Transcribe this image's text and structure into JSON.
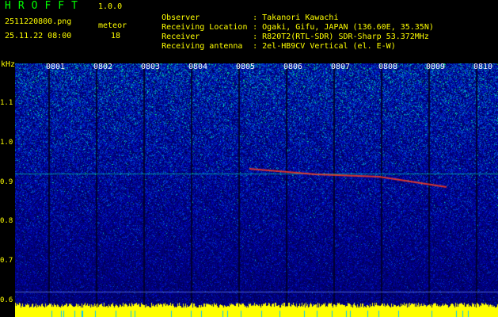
{
  "app": {
    "title": "HROFFT",
    "version": "1.0.0",
    "file_name": "2511220800.png",
    "datetime": "25.11.22 08:00",
    "meteor_label": "meteor",
    "meteor_count": "18"
  },
  "info": {
    "observer_key": "Observer",
    "observer_val": ": Takanori Kawachi",
    "location_key": "Receiving Location",
    "location_val": ": Ogaki, Gifu, JAPAN (136.60E, 35.35N)",
    "receiver_key": "Receiver",
    "receiver_val": ": R820T2(RTL-SDR) SDR-Sharp 53.372MHz",
    "antenna_key": "Receiving antenna",
    "antenna_val": ": 2el-HB9CV Vertical (el. E-W)"
  },
  "axis": {
    "unit": "kHz",
    "yticks": [
      "1.1",
      "1.0",
      "0.9",
      "0.8",
      "0.7",
      "0.6"
    ],
    "times": [
      "0801",
      "0802",
      "0803",
      "0804",
      "0805",
      "0806",
      "0807",
      "0808",
      "0809",
      "0810"
    ]
  }
}
